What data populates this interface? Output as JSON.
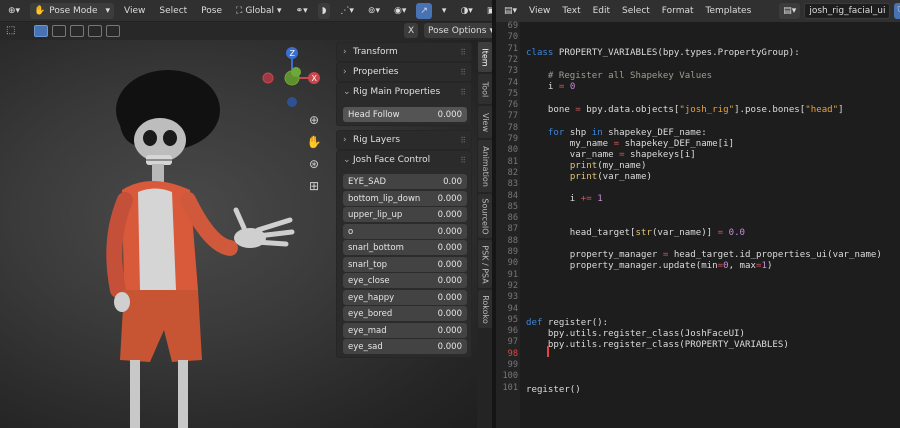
{
  "viewport_header": {
    "mode": "Pose Mode",
    "menu": [
      "View",
      "Select",
      "Pose"
    ],
    "transform_orientation": "Global"
  },
  "viewport_toolbar": {
    "pose_options": "Pose Options",
    "close_label": "X"
  },
  "npanel": {
    "transform": "Transform",
    "properties": "Properties",
    "rig_main": "Rig Main Properties",
    "head_follow": {
      "label": "Head Follow",
      "value": "0.000"
    },
    "rig_layers": "Rig Layers",
    "face_control": "Josh Face Control",
    "face_props": [
      {
        "label": "EYE_SAD",
        "value": "0.00"
      },
      {
        "label": "bottom_lip_down",
        "value": "0.000"
      },
      {
        "label": "upper_lip_up",
        "value": "0.000"
      },
      {
        "label": "o",
        "value": "0.000"
      },
      {
        "label": "snarl_bottom",
        "value": "0.000"
      },
      {
        "label": "snarl_top",
        "value": "0.000"
      },
      {
        "label": "eye_close",
        "value": "0.000"
      },
      {
        "label": "eye_happy",
        "value": "0.000"
      },
      {
        "label": "eye_bored",
        "value": "0.000"
      },
      {
        "label": "eye_mad",
        "value": "0.000"
      },
      {
        "label": "eye_sad",
        "value": "0.000"
      }
    ]
  },
  "side_tabs": [
    "Item",
    "Tool",
    "View",
    "Animation",
    "SourceIO",
    "PSK / PSA",
    "Rokoko"
  ],
  "text_editor": {
    "menu": [
      "View",
      "Text",
      "Edit",
      "Select",
      "Format",
      "Templates"
    ],
    "filename": "josh_rig_facial_ui",
    "line_numbers": [
      "69",
      "70",
      "71",
      "72",
      "73",
      "74",
      "75",
      "76",
      "77",
      "78",
      "79",
      "80",
      "81",
      "82",
      "83",
      "84",
      "85",
      "86",
      "87",
      "88",
      "89",
      "90",
      "91",
      "92",
      "93",
      "94",
      "95",
      "96",
      "97",
      "98",
      "99",
      "100",
      "101"
    ],
    "current_line": "98"
  },
  "colors": {
    "accent": "#4772b3",
    "keyword": "#3f86d6",
    "string": "#e6a23c",
    "number": "#c98bd9",
    "comment": "#9aa08c",
    "line_cursor": "#e04646"
  }
}
